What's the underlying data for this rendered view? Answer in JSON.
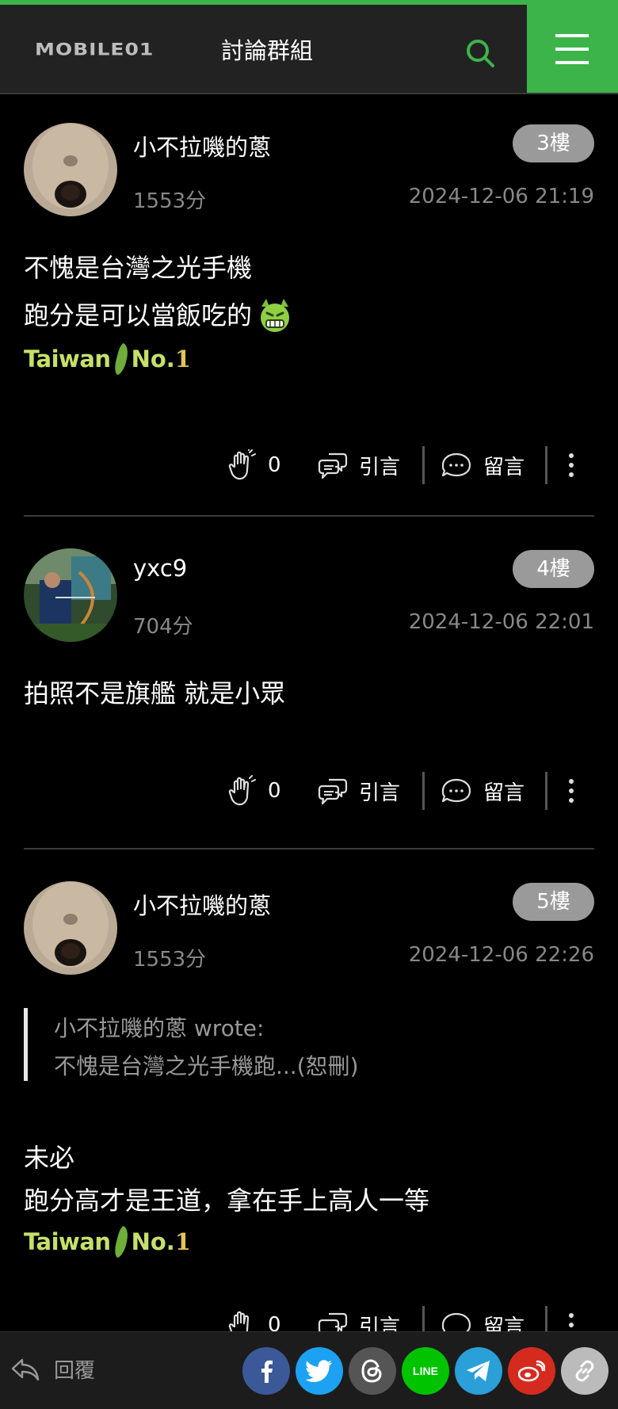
{
  "header": {
    "logo_text": "MOBILE01",
    "title": "討論群組",
    "accent_color": "#3cb44a"
  },
  "posts": [
    {
      "username": "小不拉嘰的蔥",
      "score": "1553分",
      "floor": "3樓",
      "time": "2024-12-06 21:19",
      "lines": [
        "不愧是台灣之光手機",
        "跑分是可以當飯吃的"
      ],
      "emoji": "green-devil-grin-emoji",
      "sticker": {
        "text": "Taiwan",
        "no": "No.",
        "one": "1"
      },
      "likes": "0",
      "quote_label": "引言",
      "comment_label": "留言"
    },
    {
      "username": "yxc9",
      "score": "704分",
      "floor": "4樓",
      "time": "2024-12-06 22:01",
      "lines": [
        "拍照不是旗艦 就是小眾"
      ],
      "likes": "0",
      "quote_label": "引言",
      "comment_label": "留言"
    },
    {
      "username": "小不拉嘰的蔥",
      "score": "1553分",
      "floor": "5樓",
      "time": "2024-12-06 22:26",
      "quote": {
        "author_line": "小不拉嘰的蔥 wrote:",
        "excerpt": "不愧是台灣之光手機跑...(恕刪)"
      },
      "lines": [
        "未必",
        "跑分高才是王道，拿在手上高人一等"
      ],
      "sticker": {
        "text": "Taiwan",
        "no": "No.",
        "one": "1"
      },
      "likes": "0",
      "quote_label": "引言",
      "comment_label": "留言"
    }
  ],
  "bottom_bar": {
    "reply_label": "回覆",
    "share_buttons": [
      {
        "name": "facebook",
        "color": "#3b5998"
      },
      {
        "name": "twitter",
        "color": "#1da1f2"
      },
      {
        "name": "threads",
        "color": "#555555"
      },
      {
        "name": "line",
        "label": "LINE",
        "color": "#00c300"
      },
      {
        "name": "telegram",
        "color": "#2a9fd8"
      },
      {
        "name": "weibo",
        "color": "#d52b1e"
      },
      {
        "name": "copy-link",
        "color": "#bbbbbb"
      }
    ]
  }
}
